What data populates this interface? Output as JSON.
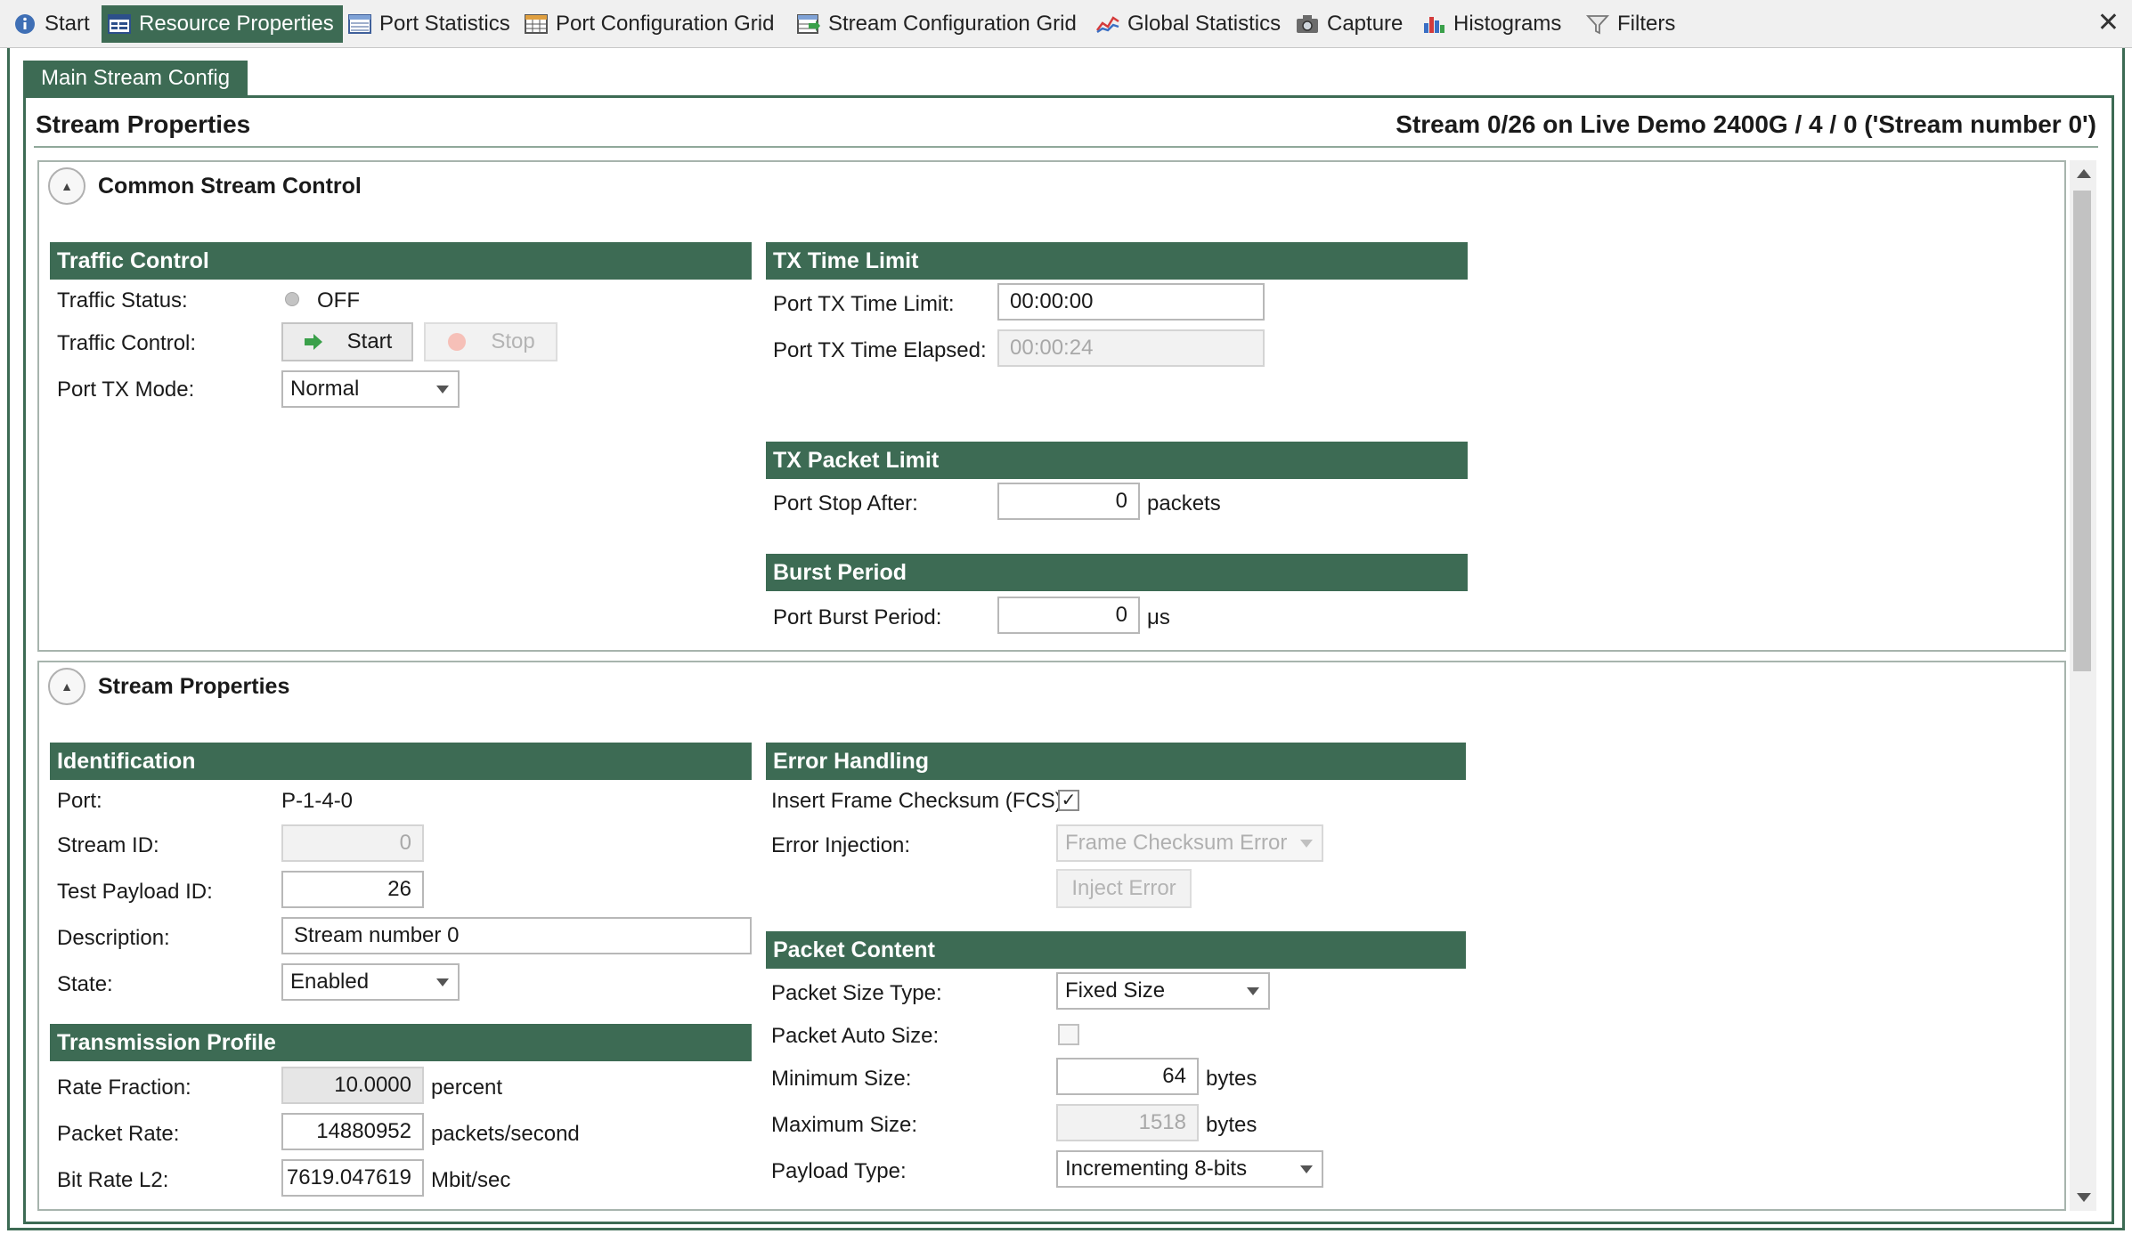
{
  "tabs": [
    {
      "label": "Start",
      "icon": "info-icon",
      "active": false
    },
    {
      "label": "Resource Properties",
      "icon": "properties-icon",
      "active": true
    },
    {
      "label": "Port Statistics",
      "icon": "table-icon",
      "active": false
    },
    {
      "label": "Port Configuration Grid",
      "icon": "grid-icon",
      "active": false
    },
    {
      "label": "Stream Configuration Grid",
      "icon": "grid-arrow-icon",
      "active": false
    },
    {
      "label": "Global Statistics",
      "icon": "line-chart-icon",
      "active": false
    },
    {
      "label": "Capture",
      "icon": "camera-icon",
      "active": false
    },
    {
      "label": "Histograms",
      "icon": "bar-chart-icon",
      "active": false
    },
    {
      "label": "Filters",
      "icon": "funnel-icon",
      "active": false
    }
  ],
  "close_symbol": "✕",
  "subtab": "Main Stream Config",
  "header": {
    "title": "Stream Properties",
    "stream": "Stream 0/26 on Live Demo 2400G / 4 / 0 ('Stream number 0')"
  },
  "common": {
    "heading": "Common Stream Control",
    "traffic_control": {
      "title": "Traffic Control",
      "status_label": "Traffic Status:",
      "status_value": "OFF",
      "control_label": "Traffic Control:",
      "start_button": "Start",
      "stop_button": "Stop",
      "tx_mode_label": "Port TX Mode:",
      "tx_mode_value": "Normal"
    },
    "tx_time_limit": {
      "title": "TX Time Limit",
      "limit_label": "Port TX Time Limit:",
      "limit_value": "00:00:00",
      "elapsed_label": "Port TX Time Elapsed:",
      "elapsed_value": "00:00:24"
    },
    "tx_packet_limit": {
      "title": "TX Packet Limit",
      "stop_label": "Port Stop After:",
      "stop_value": "0",
      "stop_unit": "packets"
    },
    "burst_period": {
      "title": "Burst Period",
      "label": "Port Burst Period:",
      "value": "0",
      "unit": "μs"
    }
  },
  "stream": {
    "heading": "Stream Properties",
    "identification": {
      "title": "Identification",
      "port_label": "Port:",
      "port_value": "P-1-4-0",
      "id_label": "Stream ID:",
      "id_value": "0",
      "payload_label": "Test Payload ID:",
      "payload_value": "26",
      "desc_label": "Description:",
      "desc_value": "Stream number 0",
      "state_label": "State:",
      "state_value": "Enabled"
    },
    "transmission": {
      "title": "Transmission Profile",
      "rate_label": "Rate Fraction:",
      "rate_value": "10.0000",
      "rate_unit": "percent",
      "packet_rate_label": "Packet Rate:",
      "packet_rate_value": "14880952",
      "packet_rate_unit": "packets/second",
      "bitrate_label": "Bit Rate L2:",
      "bitrate_value": "7619.047619",
      "bitrate_unit": "Mbit/sec"
    },
    "error_handling": {
      "title": "Error Handling",
      "fcs_label": "Insert Frame Checksum (FCS):",
      "fcs_checked": true,
      "injection_label": "Error Injection:",
      "injection_value": "Frame Checksum Error",
      "inject_button": "Inject Error"
    },
    "packet_content": {
      "title": "Packet Content",
      "size_type_label": "Packet Size Type:",
      "size_type_value": "Fixed Size",
      "auto_size_label": "Packet Auto Size:",
      "auto_size_checked": false,
      "min_label": "Minimum Size:",
      "min_value": "64",
      "min_unit": "bytes",
      "max_label": "Maximum Size:",
      "max_value": "1518",
      "max_unit": "bytes",
      "payload_type_label": "Payload Type:",
      "payload_type_value": "Incrementing 8-bits"
    }
  }
}
